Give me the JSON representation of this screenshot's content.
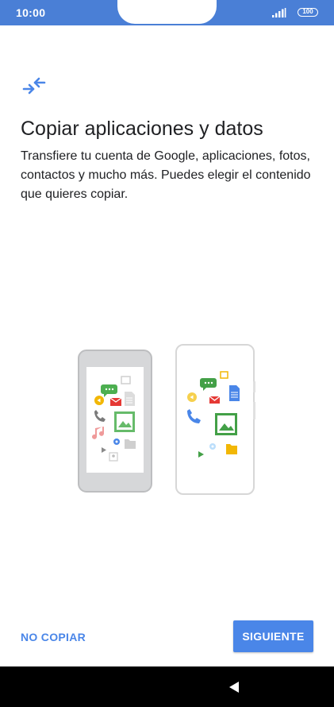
{
  "status_bar": {
    "time": "10:00",
    "battery": "100",
    "color": "#4a7fd6"
  },
  "screen": {
    "icon": "transfer-arrows-icon",
    "title": "Copiar aplicaciones y datos",
    "description": "Transfiere tu cuenta de Google, aplicaciones, fotos, contactos y mucho más. Puedes elegir el contenido que quieres copiar.",
    "illustration": "two-phones-transfer-illustration"
  },
  "actions": {
    "skip_label": "NO COPIAR",
    "next_label": "SIGUIENTE",
    "accent_color": "#4a86e8"
  },
  "nav_bar": {
    "back_icon": "back-triangle-icon"
  }
}
